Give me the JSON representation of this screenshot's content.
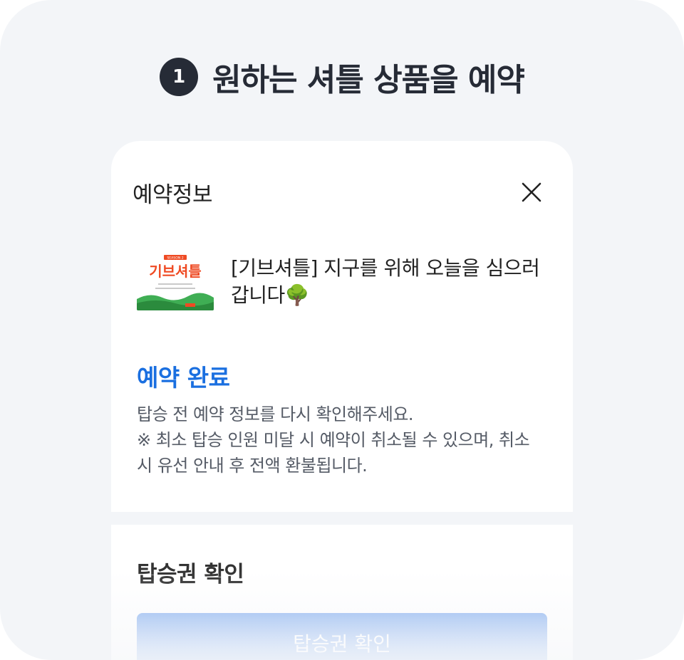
{
  "step": {
    "number": "1",
    "title": "원하는 셔틀 상품을 예약"
  },
  "sheet": {
    "title": "예약정보",
    "close_icon": "close-icon",
    "product": {
      "thumb_season": "SEASON 2",
      "thumb_logo": "기브셔틀",
      "name_line1": "[기브셔틀] 지구를 위해 오늘을 심으러",
      "name_line2": "갑니다🌳"
    },
    "status": "예약 완료",
    "notice": [
      "탑승 전 예약 정보를 다시 확인해주세요.",
      "※ 최소 탑승 인원 미달 시 예약이 취소될 수 있으며, 취소",
      "시 유선 안내 후 전액 환불됩니다."
    ]
  },
  "ticket": {
    "heading": "탑승권 확인",
    "button_label": "탑승권 확인"
  },
  "colors": {
    "background": "#f3f5f8",
    "accent": "#1a6fe0",
    "button": "#9bbdf2",
    "thumb_brand": "#ef4a23"
  }
}
